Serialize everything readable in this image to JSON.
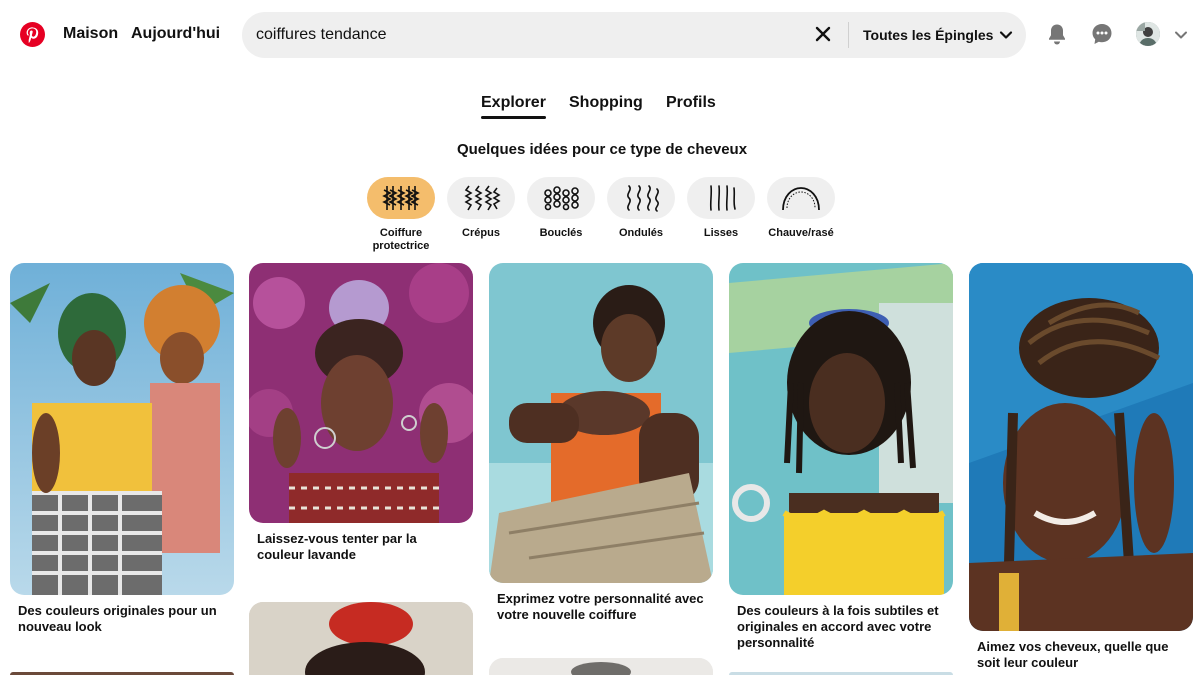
{
  "header": {
    "nav": {
      "home": "Maison",
      "today": "Aujourd'hui"
    },
    "search": {
      "query": "coiffures tendance",
      "filter_label": "Toutes les Épingles"
    },
    "icons": [
      "pinterest-logo-icon",
      "close-icon",
      "chevron-down-icon",
      "bell-icon",
      "chat-icon",
      "chevron-down-icon"
    ]
  },
  "tabs": {
    "explore": "Explorer",
    "shopping": "Shopping",
    "profiles": "Profils",
    "active": "Explorer"
  },
  "ideas": {
    "title": "Quelques idées pour ce type de cheveux",
    "chips": [
      {
        "label": "Coiffure protectrice",
        "active": true
      },
      {
        "label": "Crépus",
        "active": false
      },
      {
        "label": "Bouclés",
        "active": false
      },
      {
        "label": "Ondulés",
        "active": false
      },
      {
        "label": "Lisses",
        "active": false
      },
      {
        "label": "Chauve/rasé",
        "active": false
      }
    ]
  },
  "pins": [
    {
      "caption": "Des couleurs originales pour un nouveau look"
    },
    {
      "caption": "Laissez-vous tenter par la couleur lavande"
    },
    {
      "caption": "Exprimez votre personnalité avec votre nouvelle coiffure"
    },
    {
      "caption": "Des couleurs à la fois subtiles et originales en accord avec votre personnalité"
    },
    {
      "caption": "Aimez vos cheveux, quelle que soit leur couleur"
    }
  ],
  "colors": {
    "brand": "#e60023",
    "active_chip": "#f4bd6c",
    "search_bg": "#efefef"
  }
}
